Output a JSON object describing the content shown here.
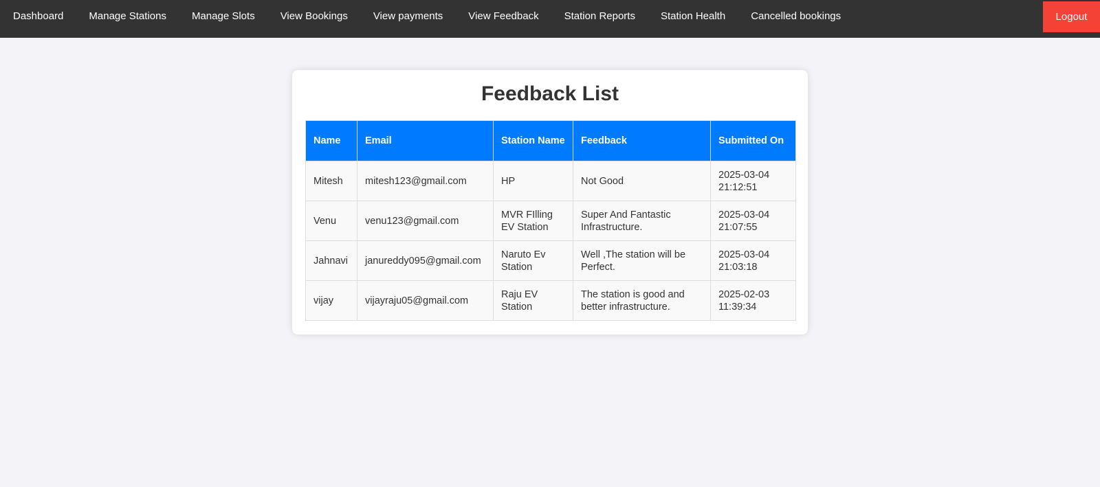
{
  "nav": {
    "items": [
      {
        "label": "Dashboard"
      },
      {
        "label": "Manage Stations"
      },
      {
        "label": "Manage Slots"
      },
      {
        "label": "View Bookings"
      },
      {
        "label": "View payments"
      },
      {
        "label": "View Feedback"
      },
      {
        "label": "Station Reports"
      },
      {
        "label": "Station Health"
      },
      {
        "label": "Cancelled bookings"
      }
    ],
    "logout_label": "Logout"
  },
  "colors": {
    "navbar": "#333333",
    "logout": "#f44336",
    "table_header": "#007bff",
    "page_background": "#f4f4f8"
  },
  "main": {
    "title": "Feedback List",
    "table": {
      "headers": [
        "Name",
        "Email",
        "Station Name",
        "Feedback",
        "Submitted On"
      ],
      "rows": [
        {
          "name": "Mitesh",
          "email": "mitesh123@gmail.com",
          "station": "HP",
          "feedback": "Not Good",
          "submitted": "2025-03-04 21:12:51"
        },
        {
          "name": "Venu",
          "email": "venu123@gmail.com",
          "station": "MVR FIlling EV Station",
          "feedback": "Super And Fantastic Infrastructure.",
          "submitted": "2025-03-04 21:07:55"
        },
        {
          "name": "Jahnavi",
          "email": "janureddy095@gmail.com",
          "station": "Naruto Ev Station",
          "feedback": "Well ,The station will be Perfect.",
          "submitted": "2025-03-04 21:03:18"
        },
        {
          "name": "vijay",
          "email": "vijayraju05@gmail.com",
          "station": "Raju EV Station",
          "feedback": "The station is good and better infrastructure.",
          "submitted": "2025-02-03 11:39:34"
        }
      ]
    }
  }
}
